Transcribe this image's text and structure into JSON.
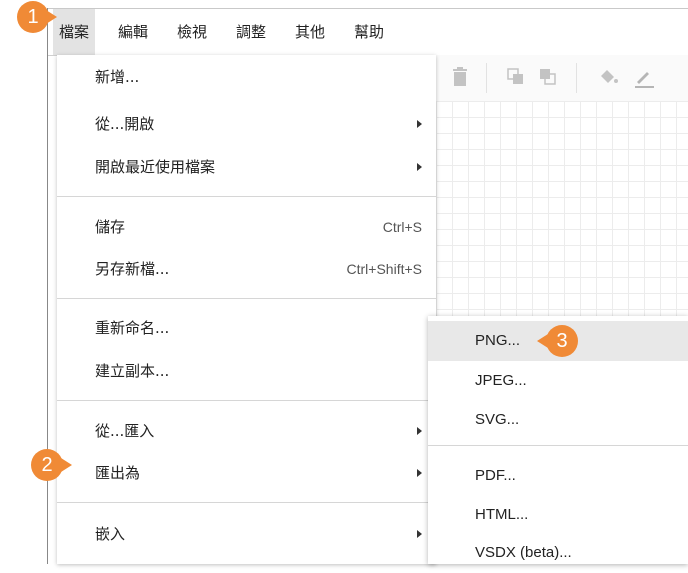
{
  "menubar": {
    "items": [
      "檔案",
      "編輯",
      "檢視",
      "調整",
      "其他",
      "幫助"
    ]
  },
  "file_menu": {
    "new": "新增...",
    "open_from": "從...開啟",
    "open_recent": "開啟最近使用檔案",
    "save": "儲存",
    "save_shortcut": "Ctrl+S",
    "save_as": "另存新檔...",
    "save_as_shortcut": "Ctrl+Shift+S",
    "rename": "重新命名...",
    "duplicate": "建立副本...",
    "import_from": "從...匯入",
    "export_as": "匯出為",
    "embed": "嵌入"
  },
  "export_submenu": {
    "items": [
      "PNG...",
      "JPEG...",
      "SVG...",
      "PDF...",
      "HTML...",
      "VSDX (beta)..."
    ]
  },
  "callouts": [
    "1",
    "2",
    "3"
  ],
  "colors": {
    "callout": "#f08a36",
    "menu_active": "#e3e3e3",
    "highlight": "#e8e8e8"
  },
  "icons": [
    "delete-icon",
    "to-front-icon",
    "to-back-icon",
    "fill-color-icon",
    "line-color-icon"
  ]
}
